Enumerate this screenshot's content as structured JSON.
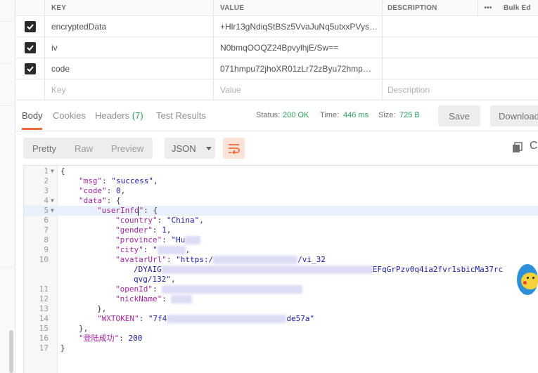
{
  "params_table": {
    "headers": {
      "key": "KEY",
      "value": "VALUE",
      "description": "DESCRIPTION",
      "more": "•••",
      "bulk_edit": "Bulk Ed"
    },
    "rows": [
      {
        "key": "encryptedData",
        "value": "+Hlr13gNdiqStBSz5VvaJuNq5utxxPVys…",
        "description": "",
        "checked": true
      },
      {
        "key": "iv",
        "value": "N0bmqOOQZ24BpvylhjE/Sw==",
        "description": "",
        "checked": true
      },
      {
        "key": "code",
        "value": "071hmpu72jhoXR01zLr72zByu72hmp…",
        "description": "",
        "checked": true
      }
    ],
    "new_row": {
      "key_placeholder": "Key",
      "value_placeholder": "Value",
      "description_placeholder": "Description"
    }
  },
  "response": {
    "tabs": {
      "body": "Body",
      "cookies": "Cookies",
      "headers": "Headers",
      "headers_count": "(7)",
      "test_results": "Test Results"
    },
    "status_label": "Status:",
    "status_value": "200 OK",
    "time_label": "Time:",
    "time_value": "446 ms",
    "size_label": "Size:",
    "size_value": "725 B",
    "save_button": "Save",
    "download_button": "Download",
    "accent_color": "#f26b3a",
    "success_color": "#2e9f5b"
  },
  "format_toolbar": {
    "modes": [
      "Pretty",
      "Raw",
      "Preview"
    ],
    "selected_mode": "Pretty",
    "language": "JSON",
    "wrap_icon": "wrap-lines-icon",
    "copy_icon": "copy-icon",
    "search_icon": "search-icon"
  },
  "code_lines": [
    {
      "n": "1",
      "fold": true,
      "indent": 0,
      "parts": [
        [
          "p",
          "{"
        ]
      ]
    },
    {
      "n": "2",
      "indent": 1,
      "parts": [
        [
          "k",
          "\"msg\""
        ],
        [
          "p",
          ": "
        ],
        [
          "s",
          "\"success\""
        ],
        [
          "p",
          ","
        ]
      ]
    },
    {
      "n": "3",
      "indent": 1,
      "parts": [
        [
          "k",
          "\"code\""
        ],
        [
          "p",
          ": "
        ],
        [
          "n",
          "0"
        ],
        [
          "p",
          ","
        ]
      ]
    },
    {
      "n": "4",
      "fold": true,
      "indent": 1,
      "parts": [
        [
          "k",
          "\"data\""
        ],
        [
          "p",
          ": {"
        ]
      ]
    },
    {
      "n": "5",
      "fold": true,
      "indent": 2,
      "current": true,
      "parts": [
        [
          "k",
          "\"userInfo\""
        ],
        [
          "p",
          ": {"
        ]
      ]
    },
    {
      "n": "6",
      "indent": 3,
      "parts": [
        [
          "k",
          "\"country\""
        ],
        [
          "p",
          ": "
        ],
        [
          "s",
          "\"China\""
        ],
        [
          "p",
          ","
        ]
      ]
    },
    {
      "n": "7",
      "indent": 3,
      "parts": [
        [
          "k",
          "\"gender\""
        ],
        [
          "p",
          ": "
        ],
        [
          "n",
          "1"
        ],
        [
          "p",
          ","
        ]
      ]
    },
    {
      "n": "8",
      "indent": 3,
      "parts": [
        [
          "k",
          "\"province\""
        ],
        [
          "p",
          ": "
        ],
        [
          "s",
          "\"Hu"
        ]
      ],
      "blur": 22
    },
    {
      "n": "9",
      "indent": 3,
      "parts": [
        [
          "k",
          "\"city\""
        ],
        [
          "p",
          ": "
        ],
        [
          "s",
          "\""
        ]
      ],
      "blur": 40,
      "tail": ","
    },
    {
      "n": "10",
      "indent": 3,
      "parts": [
        [
          "k",
          "\"avatarUrl\""
        ],
        [
          "p",
          ": "
        ],
        [
          "s",
          "\"https:/"
        ]
      ],
      "blur": 120,
      "tail2": "/vi_32"
    },
    {
      "n": "",
      "indent": 4,
      "parts": [
        [
          "s",
          "/DYAIG"
        ]
      ],
      "blur": 300,
      "tail2": "EFqGrPzv0q4ia2fvr1sbicMa37rc"
    },
    {
      "n": "",
      "indent": 4,
      "parts": [
        [
          "s",
          "qvg/132\""
        ],
        [
          "p",
          ","
        ]
      ]
    },
    {
      "n": "11",
      "indent": 3,
      "parts": [
        [
          "k",
          "\"openId\""
        ],
        [
          "p",
          ": "
        ]
      ],
      "blur": 200
    },
    {
      "n": "12",
      "indent": 3,
      "parts": [
        [
          "k",
          "\"nickName\""
        ],
        [
          "p",
          ": "
        ]
      ],
      "blur": 30
    },
    {
      "n": "13",
      "indent": 2,
      "parts": [
        [
          "p",
          "},"
        ]
      ]
    },
    {
      "n": "14",
      "indent": 2,
      "parts": [
        [
          "k",
          "\"WXTOKEN\""
        ],
        [
          "p",
          ": "
        ],
        [
          "s",
          "\"7f4"
        ]
      ],
      "blur": 170,
      "tail2": "de57a\""
    },
    {
      "n": "15",
      "indent": 1,
      "parts": [
        [
          "p",
          "},"
        ]
      ]
    },
    {
      "n": "16",
      "indent": 1,
      "parts": [
        [
          "k",
          "\"登陆成功\""
        ],
        [
          "p",
          ": "
        ],
        [
          "n",
          "200"
        ]
      ]
    },
    {
      "n": "17",
      "indent": 0,
      "parts": [
        [
          "p",
          "}"
        ]
      ]
    }
  ]
}
